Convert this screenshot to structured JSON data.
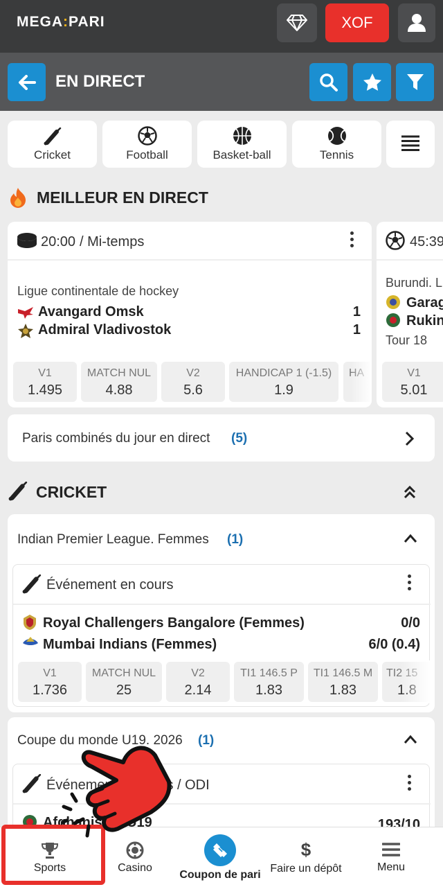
{
  "header": {
    "logo_left": "MEGA",
    "logo_right": "PARI",
    "currency": "XOF"
  },
  "subheader": {
    "title": "EN DIRECT"
  },
  "sport_tabs": [
    {
      "label": "Cricket"
    },
    {
      "label": "Football"
    },
    {
      "label": "Basket-ball"
    },
    {
      "label": "Tennis"
    }
  ],
  "best_live": {
    "title": "MEILLEUR EN DIRECT",
    "match1": {
      "time": "20:00",
      "status": "/ Mi-temps",
      "league": "Ligue continentale de hockey",
      "team1": "Avangard Omsk",
      "score1": "1",
      "team2": "Admiral Vladivostok",
      "score2": "1",
      "odds": [
        {
          "label": "V1",
          "value": "1.495"
        },
        {
          "label": "MATCH NUL",
          "value": "4.88"
        },
        {
          "label": "V2",
          "value": "5.6"
        },
        {
          "label": "HANDICAP 1 (-1.5)",
          "value": "1.9"
        },
        {
          "label": "HA",
          "value": ""
        }
      ]
    },
    "match2": {
      "time": "45:39",
      "league": "Burundi. L",
      "team1": "Garag",
      "team2": "Rukin",
      "round": "Tour 18",
      "odds": [
        {
          "label": "V1",
          "value": "5.01"
        }
      ]
    }
  },
  "combo": {
    "label": "Paris combinés du jour en direct",
    "count": "(5)"
  },
  "cricket": {
    "title": "CRICKET",
    "league1": {
      "name": "Indian Premier League. Femmes",
      "count": "(1)",
      "event": "Événement en cours",
      "team1": "Royal Challengers Bangalore (Femmes)",
      "score1": "0/0",
      "team2": "Mumbai Indians (Femmes)",
      "score2": "6/0 (0.4)",
      "odds": [
        {
          "label": "V1",
          "value": "1.736"
        },
        {
          "label": "MATCH NUL",
          "value": "25"
        },
        {
          "label": "V2",
          "value": "2.14"
        },
        {
          "label": "TI1 146.5 P",
          "value": "1.83"
        },
        {
          "label": "TI1 146.5 M",
          "value": "1.83"
        },
        {
          "label": "TI2 15",
          "value": "1.8"
        }
      ]
    },
    "league2": {
      "name": "Coupe du monde U19. 2026",
      "count": "(1)",
      "event": "Événement en cours / ODI",
      "team1": "Afghanistan U19",
      "score1": "193/10"
    }
  },
  "bottom_nav": [
    {
      "label": "Sports"
    },
    {
      "label": "Casino"
    },
    {
      "label": "Coupon de pari"
    },
    {
      "label": "Faire un dépôt"
    },
    {
      "label": "Menu"
    }
  ],
  "colors": {
    "accent": "#1b8fd1",
    "red": "#e8302b",
    "topbar": "#3a3b3c"
  }
}
